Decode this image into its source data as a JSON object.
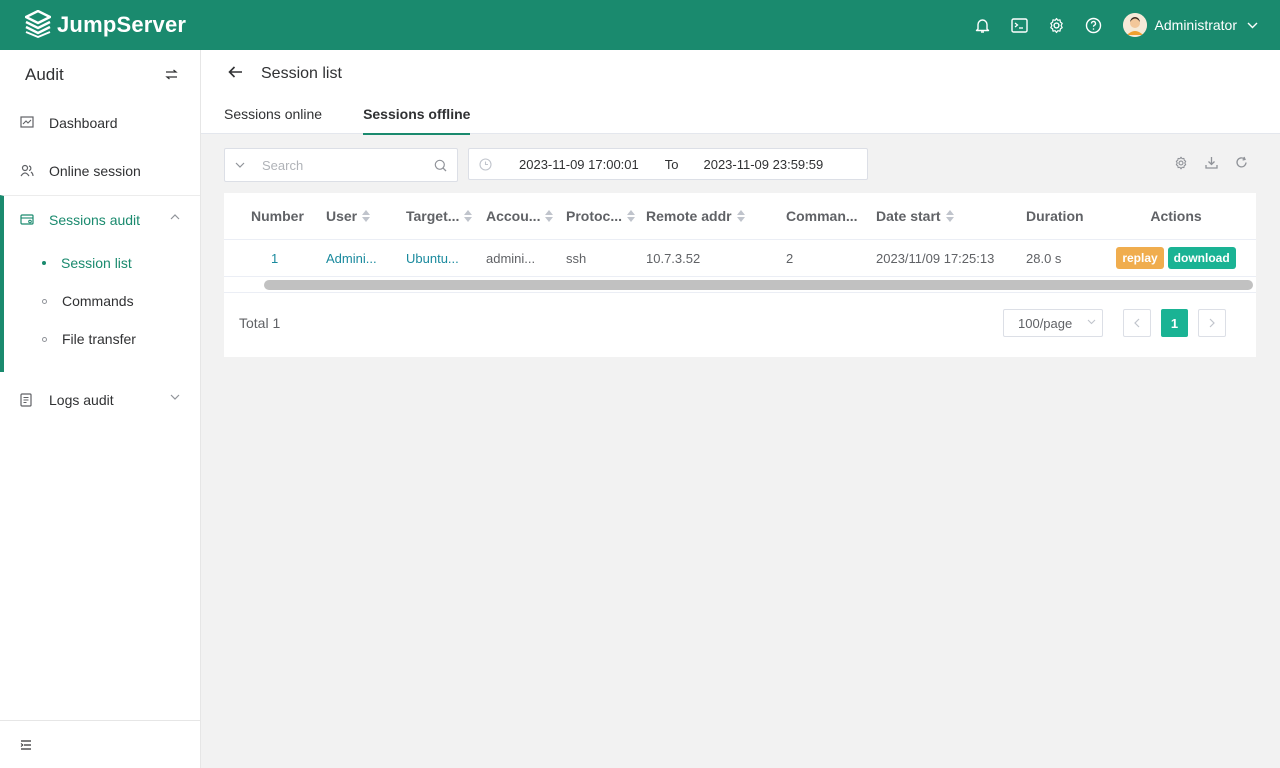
{
  "header": {
    "brand": "JumpServer",
    "user_name": "Administrator",
    "icons": [
      "bell-icon",
      "terminal-icon",
      "gear-icon",
      "help-icon"
    ],
    "bg_color": "#1a8a6e"
  },
  "sidebar": {
    "title": "Audit",
    "items": [
      {
        "label": "Dashboard",
        "icon": "chart-icon"
      },
      {
        "label": "Online session",
        "icon": "users-icon"
      },
      {
        "label": "Sessions audit",
        "icon": "session-audit-icon"
      },
      {
        "label": "Logs audit",
        "icon": "logs-icon"
      }
    ],
    "sub_items": [
      {
        "label": "Session list",
        "active": true
      },
      {
        "label": "Commands",
        "active": false
      },
      {
        "label": "File transfer",
        "active": false
      }
    ]
  },
  "page": {
    "title": "Session list",
    "tabs": [
      {
        "label": "Sessions online",
        "active": false
      },
      {
        "label": "Sessions offline",
        "active": true
      }
    ]
  },
  "filters": {
    "search_placeholder": "Search",
    "date_start": "2023-11-09 17:00:01",
    "date_separator": "To",
    "date_end": "2023-11-09 23:59:59"
  },
  "table": {
    "columns": [
      "Number",
      "User",
      "Target...",
      "Accou...",
      "Protoc...",
      "Remote addr",
      "Comman...",
      "Date start",
      "Duration",
      "Actions"
    ],
    "rows": [
      {
        "number": "1",
        "user": "Admini...",
        "target": "Ubuntu...",
        "account": "admini...",
        "protocol": "ssh",
        "remote_addr": "10.7.3.52",
        "commands": "2",
        "date_start": "2023/11/09 17:25:13",
        "duration": "28.0 s",
        "action_replay": "replay",
        "action_download": "download"
      }
    ]
  },
  "pagination": {
    "total_label": "Total 1",
    "page_size": "100/page",
    "current_page": "1"
  }
}
